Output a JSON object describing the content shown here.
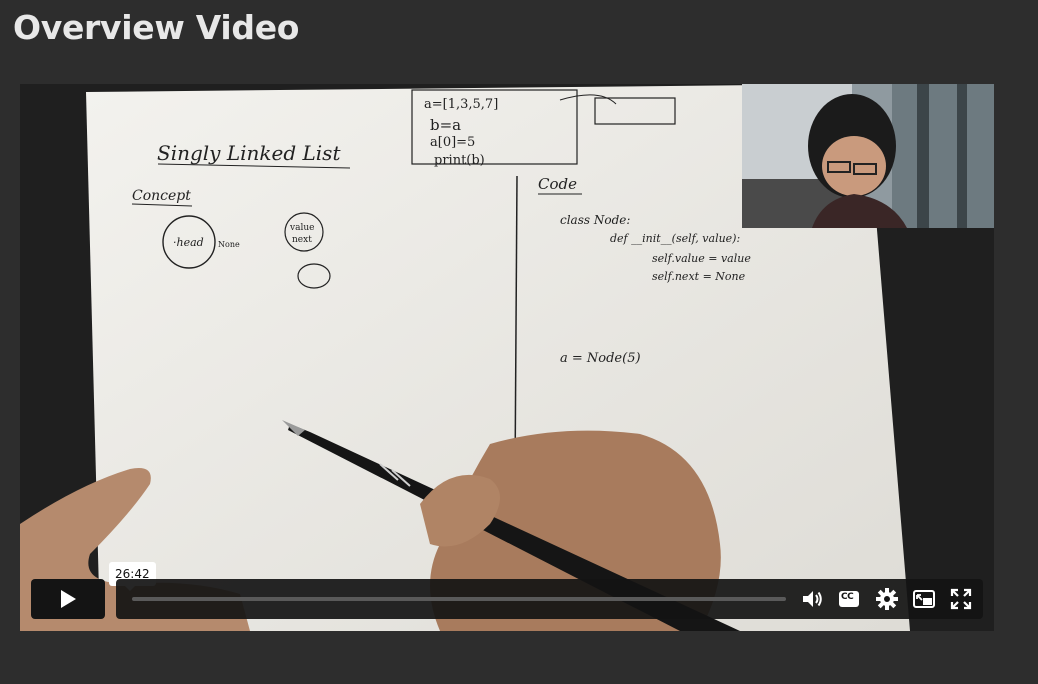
{
  "section": {
    "title": "Overview Video"
  },
  "player": {
    "tooltip_time": "26:42",
    "progress_fraction": 0.0,
    "icons": [
      "play-icon",
      "volume-icon",
      "closed-captions-icon",
      "settings-gear-icon",
      "picture-in-picture-icon",
      "fullscreen-icon"
    ],
    "cc_label": "CC"
  },
  "whiteboard": {
    "title": "Singly Linked List",
    "concept_label": "Concept",
    "head_label": "·head",
    "none_label": "None",
    "value_label": "value",
    "next_label": "next",
    "code_label": "Code",
    "code_lines": [
      "class Node:",
      "def __init__(self, value):",
      "self.value = value",
      "self.next = None",
      "a = Node(5)"
    ],
    "box_lines": [
      "a=[1,3,5,7]",
      "b=a",
      "a[0]=5",
      "print(b)"
    ]
  },
  "colors": {
    "background": "#2d2d2d",
    "control_bar": "#141414",
    "paper": "#ecebe6"
  }
}
